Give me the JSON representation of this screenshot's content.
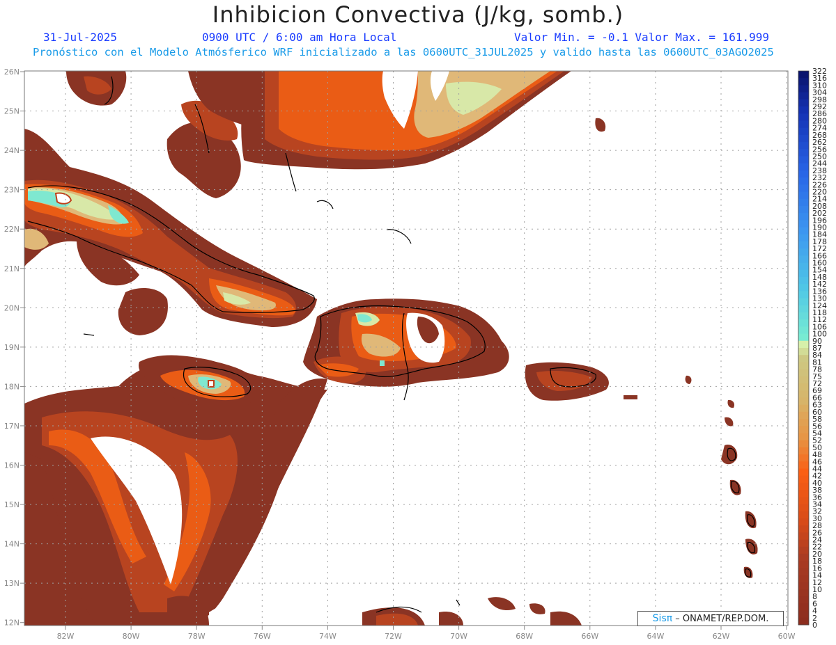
{
  "title": "Inhibicion Convectiva (J/kg, somb.)",
  "header": {
    "date": "31-Jul-2025",
    "time": "0900 UTC / 6:00 am Hora Local",
    "minmax": "Valor Min. = -0.1  Valor Max. = 161.999",
    "subtitle": "Pronóstico con el Modelo Atmósferico WRF inicializado a las 0600UTC_31JUL2025 y valido hasta las  0600UTC_03AGO2025"
  },
  "axes": {
    "lat_labels": [
      "26N",
      "25N",
      "24N",
      "23N",
      "22N",
      "21N",
      "20N",
      "19N",
      "18N",
      "17N",
      "16N",
      "15N",
      "14N",
      "13N",
      "12N"
    ],
    "lon_labels": [
      "82W",
      "80W",
      "78W",
      "76W",
      "74W",
      "72W",
      "70W",
      "68W",
      "66W",
      "64W",
      "62W",
      "60W"
    ]
  },
  "colorbar": {
    "labels": [
      "322",
      "316",
      "310",
      "304",
      "298",
      "292",
      "286",
      "280",
      "274",
      "268",
      "262",
      "256",
      "250",
      "244",
      "238",
      "232",
      "226",
      "220",
      "214",
      "208",
      "202",
      "196",
      "190",
      "184",
      "178",
      "172",
      "166",
      "160",
      "154",
      "148",
      "142",
      "136",
      "130",
      "124",
      "118",
      "112",
      "106",
      "100",
      "90",
      "87",
      "84",
      "81",
      "78",
      "75",
      "72",
      "69",
      "66",
      "63",
      "60",
      "58",
      "56",
      "54",
      "52",
      "50",
      "48",
      "46",
      "44",
      "42",
      "40",
      "38",
      "36",
      "34",
      "32",
      "30",
      "28",
      "26",
      "24",
      "22",
      "20",
      "18",
      "16",
      "14",
      "12",
      "10",
      "8",
      "6",
      "4",
      "2",
      "0"
    ]
  },
  "credit": {
    "logo": "Sisπ",
    "text": " – ONAMET/REP.DOM."
  },
  "colors": {
    "land_dark": "#8a3424",
    "mid": "#b84420",
    "orange": "#ea5c15",
    "tan": "#e0b878",
    "pale": "#d8e8a8",
    "cyan": "#7fe8d0"
  }
}
